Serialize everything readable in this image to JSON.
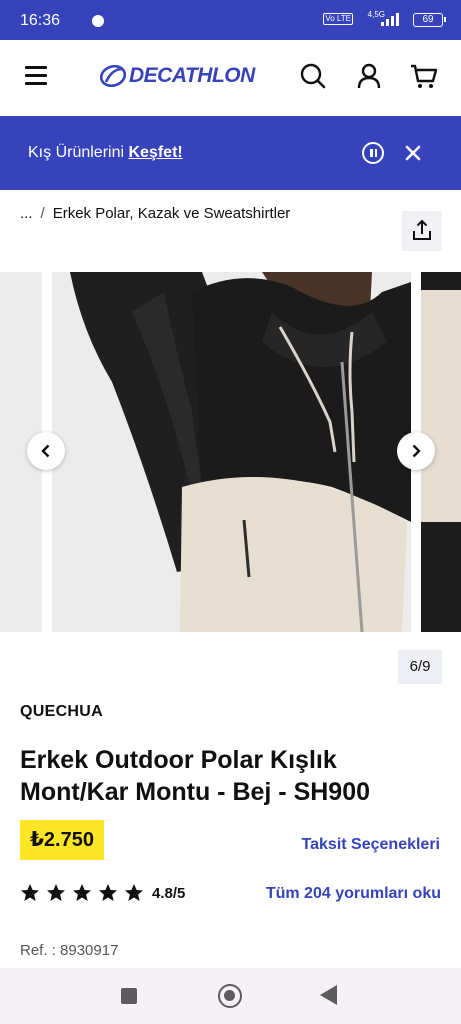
{
  "status_bar": {
    "time": "16:36",
    "network": "4,5G",
    "volte": "Vo LTE",
    "battery": "69"
  },
  "header": {
    "logo_text": "DECATHLON",
    "icons": [
      "menu-icon",
      "search-icon",
      "account-icon",
      "cart-icon"
    ]
  },
  "promo": {
    "text": "Kış Ürünlerini ",
    "link": "Keşfet!",
    "background": "#3643ba"
  },
  "breadcrumb": {
    "ellipsis": "...",
    "separator": "/",
    "current": "Erkek Polar, Kazak ve Sweatshirtler"
  },
  "gallery": {
    "counter": "6/9"
  },
  "product": {
    "brand": "QUECHUA",
    "title": "Erkek Outdoor Polar Kışlık Mont/Kar Montu - Bej - SH900",
    "price": "₺2.750",
    "installments_link": "Taksit Seçenekleri",
    "stars": 5,
    "rating": "4.8/5",
    "reviews_link": "Tüm 204 yorumları oku",
    "ref": "Ref. : 8930917"
  },
  "colors": {
    "brand_blue": "#3643ba",
    "price_yellow": "#fde626"
  }
}
